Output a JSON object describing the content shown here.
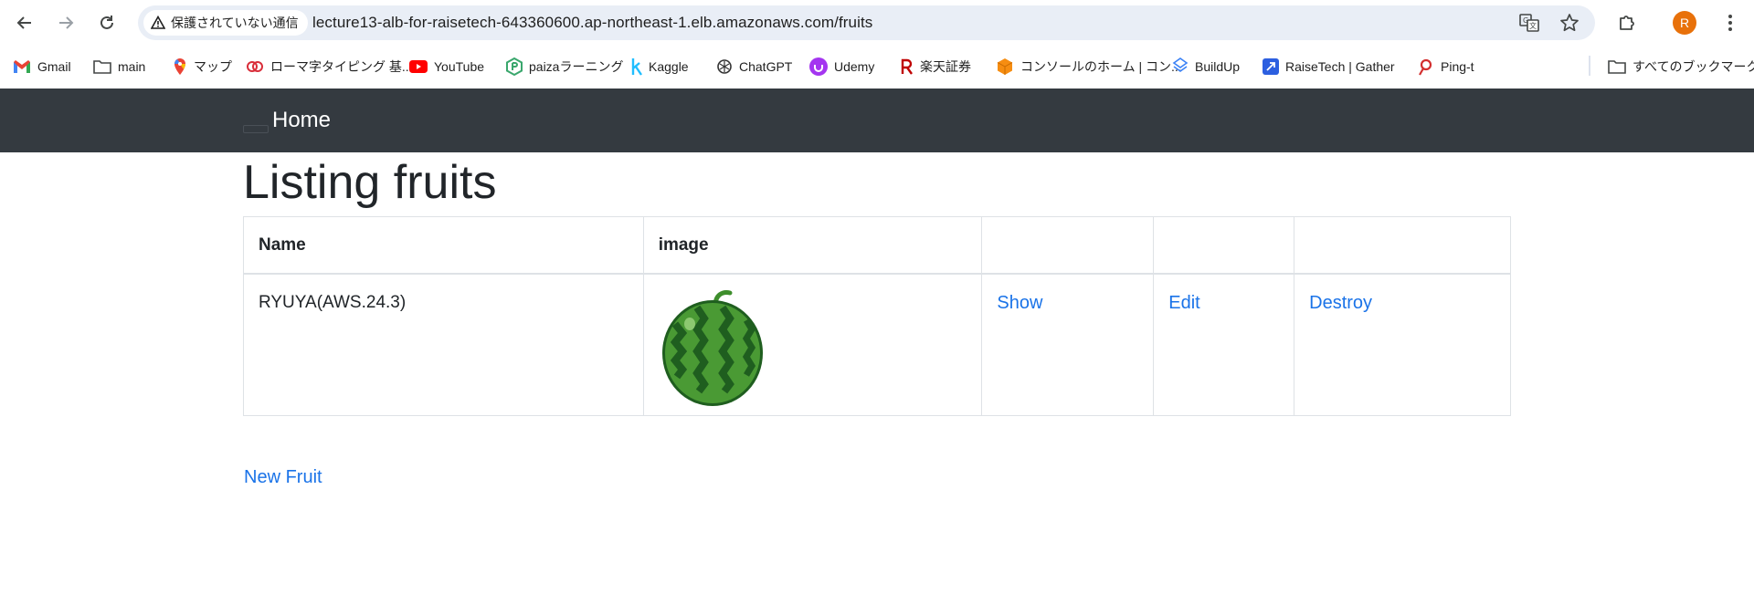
{
  "browser": {
    "security_label": "保護されていない通信",
    "url": "lecture13-alb-for-raisetech-643360600.ap-northeast-1.elb.amazonaws.com/fruits",
    "profile_initial": "R",
    "bookmarks": [
      {
        "label": "Gmail",
        "icon": "gmail-icon"
      },
      {
        "label": "main",
        "icon": "folder-icon"
      },
      {
        "label": "マップ",
        "icon": "maps-icon"
      },
      {
        "label": "ローマ字タイピング 基...",
        "icon": "typing-icon"
      },
      {
        "label": "YouTube",
        "icon": "youtube-icon"
      },
      {
        "label": "paizaラーニング",
        "icon": "paiza-icon"
      },
      {
        "label": "Kaggle",
        "icon": "kaggle-icon"
      },
      {
        "label": "ChatGPT",
        "icon": "chatgpt-icon"
      },
      {
        "label": "Udemy",
        "icon": "udemy-icon"
      },
      {
        "label": "楽天証券",
        "icon": "rakuten-icon"
      },
      {
        "label": "コンソールのホーム | コン...",
        "icon": "aws-console-icon"
      },
      {
        "label": "BuildUp",
        "icon": "buildup-icon"
      },
      {
        "label": "RaiseTech | Gather",
        "icon": "raisetech-icon"
      },
      {
        "label": "Ping-t",
        "icon": "ping-t-icon"
      }
    ],
    "all_bookmarks_label": "すべてのブックマーク"
  },
  "navbar": {
    "brand": "Home"
  },
  "page": {
    "title": "Listing fruits",
    "table": {
      "headers": [
        "Name",
        "image",
        "",
        "",
        ""
      ],
      "rows": [
        {
          "name": "RYUYA(AWS.24.3)",
          "image": "watermelon",
          "show": "Show",
          "edit": "Edit",
          "destroy": "Destroy"
        }
      ]
    },
    "new_link": "New Fruit"
  },
  "colors": {
    "navbar": "#343a40",
    "link": "#1a73e8",
    "avatar": "#e8710a"
  }
}
